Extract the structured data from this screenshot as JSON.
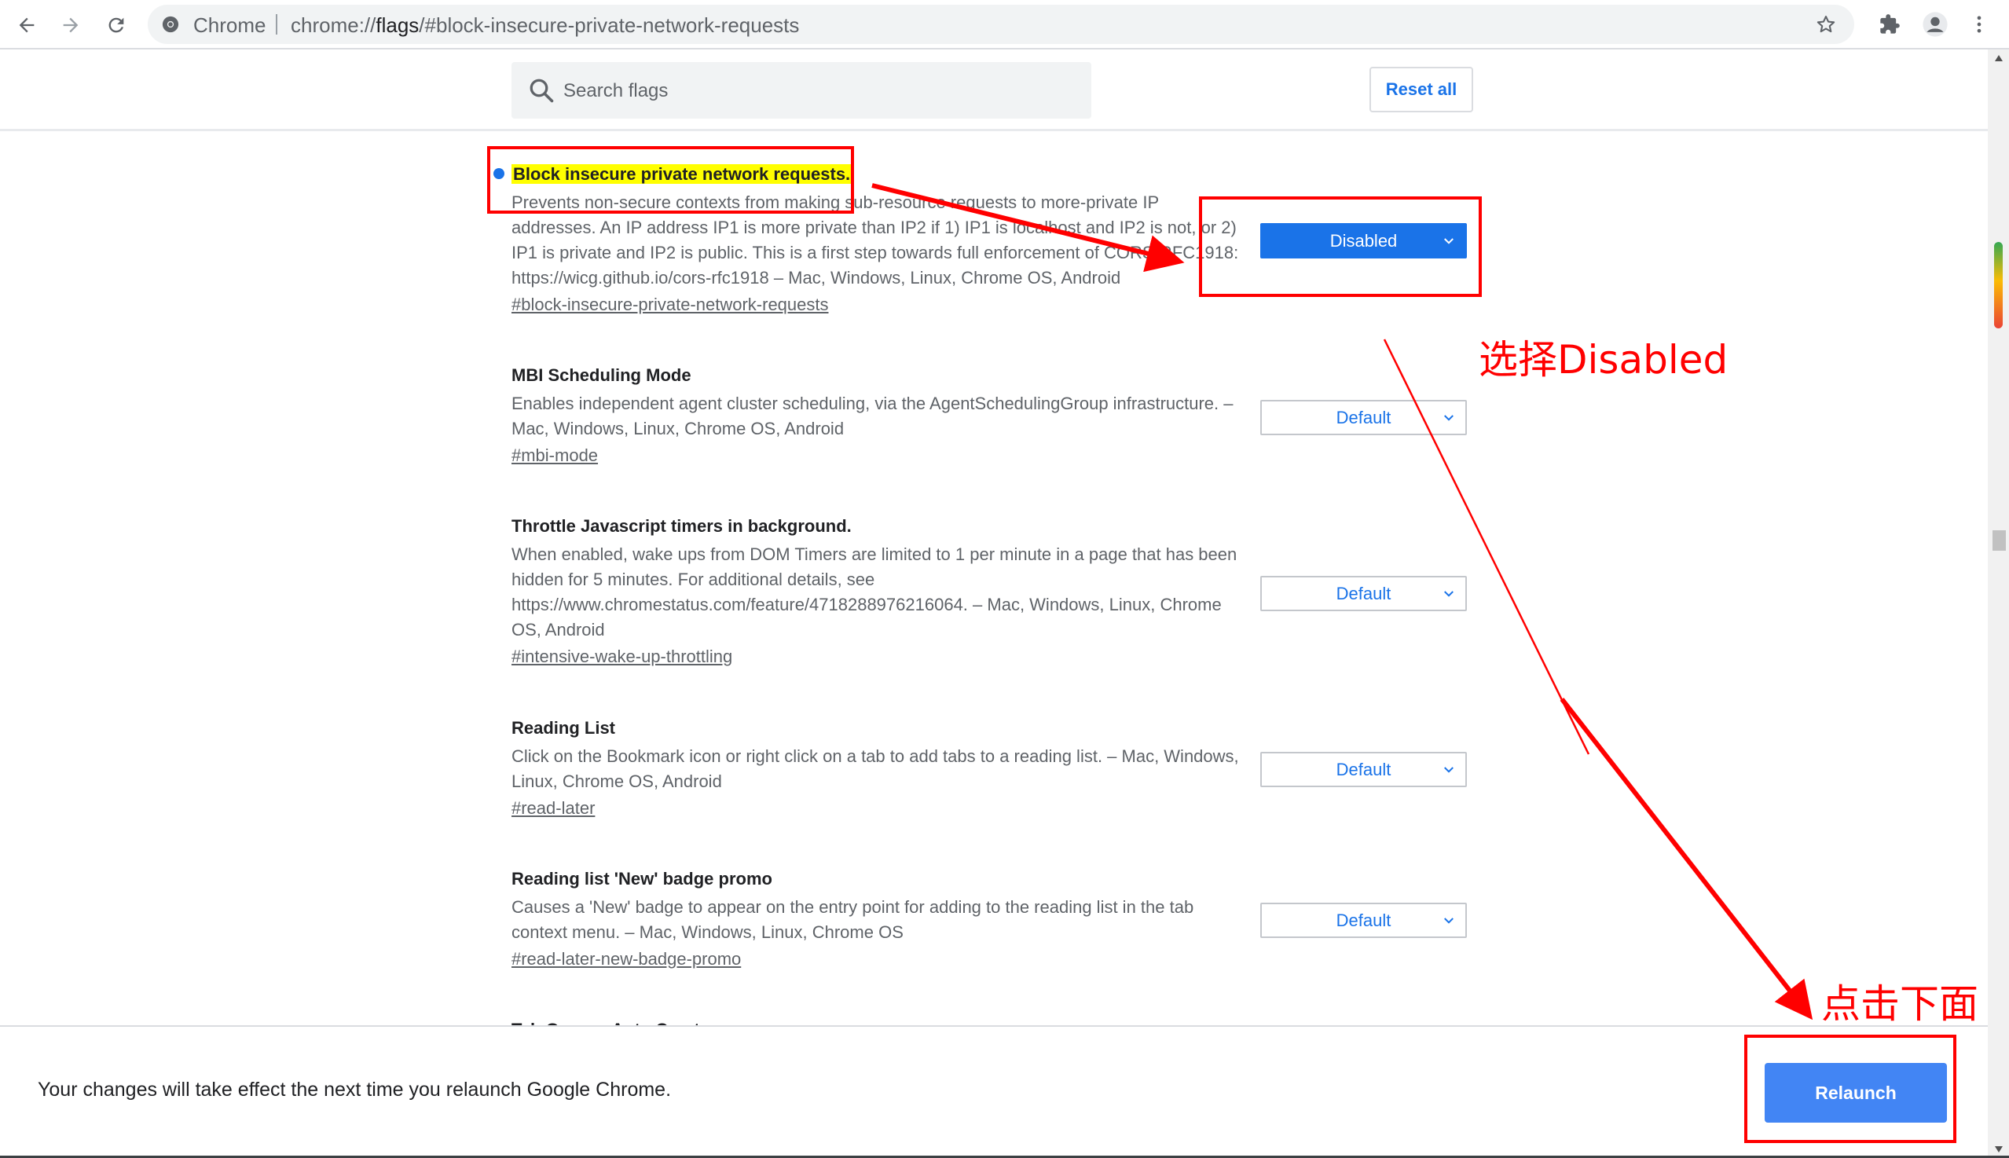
{
  "browser": {
    "site_name": "Chrome",
    "url_scheme": "chrome://",
    "url_host": "flags",
    "url_path": "/#block-insecure-private-network-requests"
  },
  "flags_page": {
    "search_placeholder": "Search flags",
    "reset_label": "Reset all",
    "flags": [
      {
        "title": "Block insecure private network requests.",
        "description": "Prevents non-secure contexts from making sub-resource requests to more-private IP addresses. An IP address IP1 is more private than IP2 if 1) IP1 is localhost and IP2 is not, or 2) IP1 is private and IP2 is public. This is a first step towards full enforcement of CORS-RFC1918: https://wicg.github.io/cors-rfc1918 – Mac, Windows, Linux, Chrome OS, Android",
        "link": "#block-insecure-private-network-requests",
        "value": "Disabled"
      },
      {
        "title": "MBI Scheduling Mode",
        "description": "Enables independent agent cluster scheduling, via the AgentSchedulingGroup infrastructure. – Mac, Windows, Linux, Chrome OS, Android",
        "link": "#mbi-mode",
        "value": "Default"
      },
      {
        "title": "Throttle Javascript timers in background.",
        "description": "When enabled, wake ups from DOM Timers are limited to 1 per minute in a page that has been hidden for 5 minutes. For additional details, see https://www.chromestatus.com/feature/4718288976216064. – Mac, Windows, Linux, Chrome OS, Android",
        "link": "#intensive-wake-up-throttling",
        "value": "Default"
      },
      {
        "title": "Reading List",
        "description": "Click on the Bookmark icon or right click on a tab to add tabs to a reading list. – Mac, Windows, Linux, Chrome OS, Android",
        "link": "#read-later",
        "value": "Default"
      },
      {
        "title": "Reading list 'New' badge promo",
        "description": "Causes a 'New' badge to appear on the entry point for adding to the reading list in the tab context menu. – Mac, Windows, Linux, Chrome OS",
        "link": "#read-later-new-badge-promo",
        "value": "Default"
      },
      {
        "title": "Tab Groups Auto Create"
      }
    ]
  },
  "relaunch_bar": {
    "message": "Your changes will take effect the next time you relaunch Google Chrome.",
    "button_label": "Relaunch"
  },
  "annotations": {
    "select_disabled": "选择Disabled",
    "click_below": "点击下面",
    "color": "#ff0000"
  },
  "colors": {
    "accent": "#1a73e8",
    "relaunch": "#4285f4",
    "highlight": "#ffff00"
  }
}
